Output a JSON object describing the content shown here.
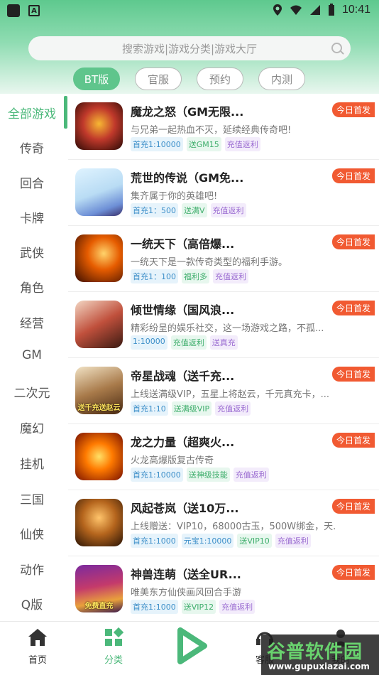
{
  "status_bar": {
    "time": "10:41"
  },
  "search": {
    "placeholder": "搜索游戏|游戏分类|游戏大厅"
  },
  "tabs": [
    {
      "label": "BT版",
      "active": true
    },
    {
      "label": "官服",
      "active": false
    },
    {
      "label": "预约",
      "active": false
    },
    {
      "label": "内测",
      "active": false
    }
  ],
  "sidebar": {
    "items": [
      "全部游戏",
      "传奇",
      "回合",
      "卡牌",
      "武侠",
      "角色",
      "经营",
      "GM",
      "二次元",
      "魔幻",
      "挂机",
      "三国",
      "仙侠",
      "动作",
      "Q版"
    ],
    "active_index": 0
  },
  "games": [
    {
      "title": "魔龙之怒（GM无限...",
      "desc": "与兄弟一起热血不灭，延续经典传奇吧!",
      "badge": "今日首发",
      "tags": [
        {
          "t": "首充1:10000",
          "c": "blue"
        },
        {
          "t": "送GM15",
          "c": "green"
        },
        {
          "t": "充值返利",
          "c": "purple"
        }
      ],
      "icon_text": ""
    },
    {
      "title": "荒世的传说（GM免...",
      "desc": "集齐属于你的英雄吧!",
      "badge": "今日首发",
      "tags": [
        {
          "t": "首充1：500",
          "c": "blue"
        },
        {
          "t": "送满V",
          "c": "green"
        },
        {
          "t": "充值返利",
          "c": "purple"
        }
      ],
      "icon_text": ""
    },
    {
      "title": " 一统天下（高倍爆...",
      "desc": "一统天下是一款传奇类型的福利手游。",
      "badge": "今日首发",
      "tags": [
        {
          "t": "首充1：100",
          "c": "blue"
        },
        {
          "t": "福利多",
          "c": "green"
        },
        {
          "t": "充值返利",
          "c": "purple"
        }
      ],
      "icon_text": ""
    },
    {
      "title": "倾世情缘（国风浪...",
      "desc": "精彩纷呈的娱乐社交，这一场游戏之路，不孤...",
      "badge": "今日首发",
      "tags": [
        {
          "t": "1:10000",
          "c": "blue"
        },
        {
          "t": "充值返利",
          "c": "green"
        },
        {
          "t": "送真充",
          "c": "purple"
        }
      ],
      "icon_text": ""
    },
    {
      "title": "帝星战魂（送千充...",
      "desc": "上线送满级VIP，五星上将赵云，千元真充卡，...",
      "badge": "今日首发",
      "tags": [
        {
          "t": "首充1:10",
          "c": "blue"
        },
        {
          "t": "送满级VIP",
          "c": "green"
        },
        {
          "t": "充值返利",
          "c": "purple"
        }
      ],
      "icon_text": "送千充送赵云"
    },
    {
      "title": "龙之力量（超爽火...",
      "desc": "火龙高爆版复古传奇",
      "badge": "今日首发",
      "tags": [
        {
          "t": "首充1:10000",
          "c": "blue"
        },
        {
          "t": "送神级技能",
          "c": "green"
        },
        {
          "t": "充值返利",
          "c": "purple"
        }
      ],
      "icon_text": ""
    },
    {
      "title": "风起苍岚（送10万...",
      "desc": "上线赠送：VIP10，68000古玉，500W绑金，天...",
      "badge": "今日首发",
      "tags": [
        {
          "t": "首充1:1000",
          "c": "blue"
        },
        {
          "t": "元宝1:10000",
          "c": "blue"
        },
        {
          "t": "送VIP10",
          "c": "green"
        },
        {
          "t": "充值返利",
          "c": "purple"
        }
      ],
      "icon_text": ""
    },
    {
      "title": "神兽连萌（送全UR...",
      "desc": "唯美东方仙侠画风回合手游",
      "badge": "今日首发",
      "tags": [
        {
          "t": "首充1:1000",
          "c": "blue"
        },
        {
          "t": "送VIP12",
          "c": "green"
        },
        {
          "t": "充值返利",
          "c": "purple"
        }
      ],
      "icon_text": "免费直充"
    }
  ],
  "bottom_nav": [
    {
      "label": "首页",
      "icon": "home-icon",
      "active": false
    },
    {
      "label": "分类",
      "icon": "category-icon",
      "active": true
    },
    {
      "label": "",
      "icon": "play-icon",
      "active": false
    },
    {
      "label": "客服",
      "icon": "headset-icon",
      "active": false
    },
    {
      "label": "我的",
      "icon": "user-icon",
      "active": false
    }
  ],
  "watermark": {
    "main": "谷普软件园",
    "url": "www.gupuxiazai.com"
  },
  "colors": {
    "accent": "#4bb87a",
    "badge": "#f15a32"
  }
}
